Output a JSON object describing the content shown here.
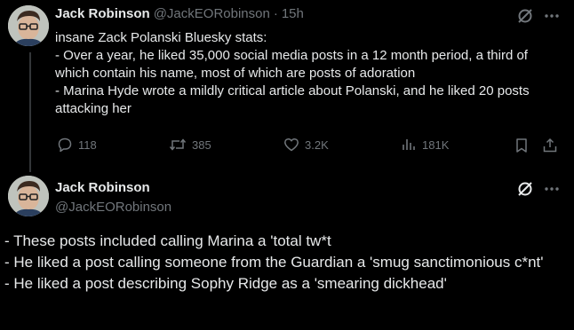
{
  "tweet1": {
    "author_name": "Jack Robinson",
    "author_handle": "@JackEORobinson",
    "separator": "·",
    "time": "15h",
    "text": "insane Zack Polanski Bluesky stats:\n- Over a year, he liked 35,000 social media posts in a 12 month period, a third of which contain his name, most of which are posts of adoration\n- Marina Hyde wrote a mildly critical article about Polanski, and he liked 20 posts attacking her",
    "actions": {
      "replies": "118",
      "reposts": "385",
      "likes": "3.2K",
      "views": "181K"
    }
  },
  "tweet2": {
    "author_name": "Jack Robinson",
    "author_handle": "@JackEORobinson",
    "text": "- These posts included calling Marina a 'total tw*t\n- He liked a post calling someone from the Guardian a 'smug sanctimonious c*nt'\n- He liked a post describing Sophy Ridge as a 'smearing dickhead'"
  },
  "icons": [
    "grok-icon",
    "more-icon",
    "reply-icon",
    "repost-icon",
    "like-icon",
    "views-icon",
    "bookmark-icon",
    "share-icon"
  ],
  "colors": {
    "background": "#000000",
    "text_primary": "#e7e9ea",
    "text_secondary": "#71767b",
    "thread_line": "#333639"
  }
}
